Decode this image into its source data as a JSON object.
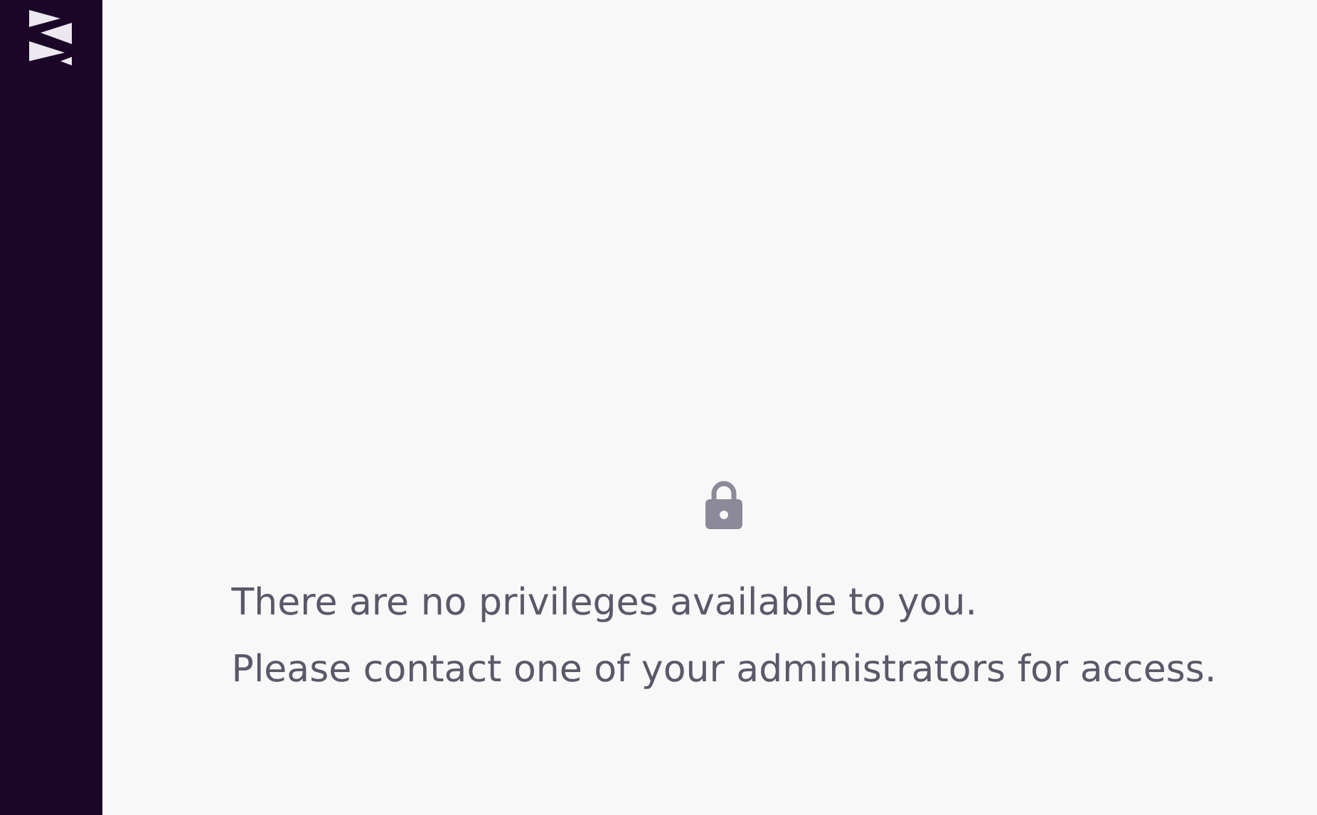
{
  "empty_state": {
    "lines": [
      "There are no privileges available to you.",
      "Please contact one of your administrators for access."
    ]
  }
}
